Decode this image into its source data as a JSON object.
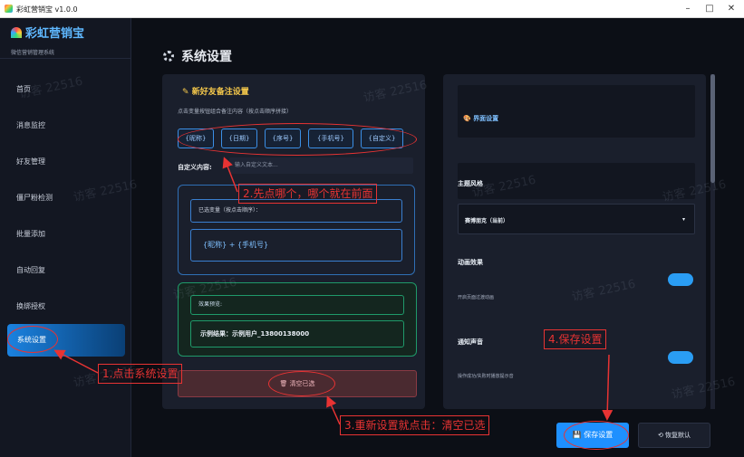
{
  "window": {
    "title": "彩虹营销宝 v1.0.0",
    "min": "–",
    "max": "□",
    "close": "✕"
  },
  "brand": {
    "name": "彩虹营销宝",
    "subtitle": "微信营销管理系统"
  },
  "sidebar": {
    "items": [
      "首页",
      "消息监控",
      "好友管理",
      "僵尸粉检测",
      "批量添加",
      "自动回复",
      "换绑授权",
      "系统设置"
    ]
  },
  "page": {
    "title": "系统设置"
  },
  "remark": {
    "title": "新好友备注设置",
    "hint": "点击变量按钮组合备注内容（按点击顺序拼接）",
    "tags": [
      "{昵称}",
      "{日期}",
      "{序号}",
      "{手机号}",
      "{自定义}"
    ],
    "custom_label": "自定义内容:",
    "custom_placeholder": "输入自定义文本...",
    "selected_label": "已选变量（按点击顺序）：",
    "selected_value": "{昵称} + {手机号}",
    "preview_label": "效果预览:",
    "preview_value": "示例结果：示例用户_13800138000",
    "clear_button": "清空已选"
  },
  "ui_settings": {
    "title": "界面设置",
    "theme_label": "主题风格",
    "theme_value": "赛博朋克（当前）",
    "animation_label": "动画效果",
    "animation_desc": "开启页面过渡动画",
    "sound_label": "通知声音",
    "sound_desc": "操作成功/失败时播放提示音"
  },
  "footer": {
    "save": "保存设置",
    "reset": "恢复默认"
  },
  "annotations": {
    "a1": "1.点击系统设置",
    "a2": "2.先点哪个，哪个就在前面",
    "a3": "3.重新设置就点击：清空已选",
    "a4": "4.保存设置"
  },
  "watermark": "访客 22516",
  "colors": {
    "accent": "#1e90ff",
    "annotation": "#e83333",
    "remark_title": "#f5c84b"
  }
}
